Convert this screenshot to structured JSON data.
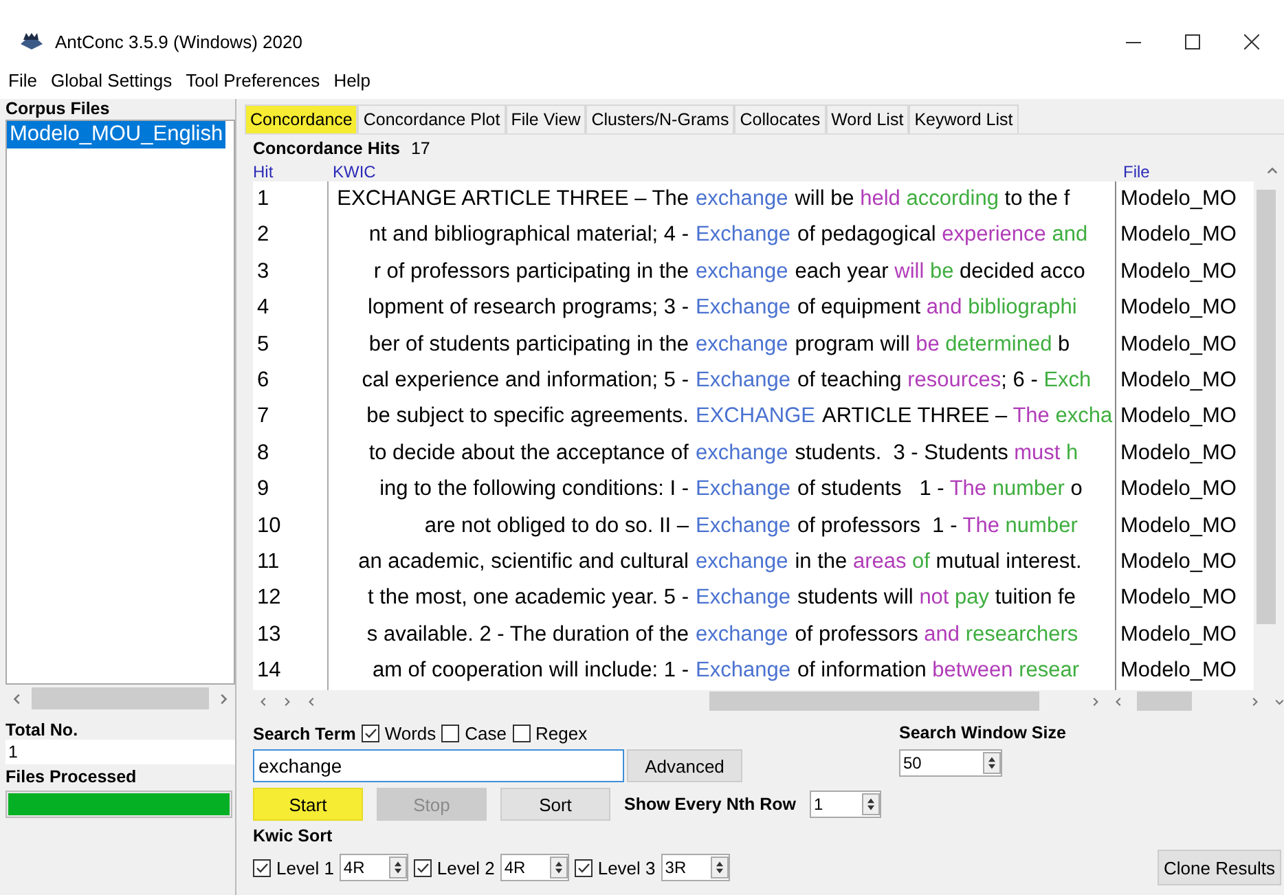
{
  "window": {
    "title": "AntConc 3.5.9 (Windows) 2020"
  },
  "menu": [
    "File",
    "Global Settings",
    "Tool Preferences",
    "Help"
  ],
  "sidebar": {
    "heading": "Corpus Files",
    "files": [
      {
        "label": "Modelo_MOU_English",
        "selected": true
      }
    ],
    "total_label": "Total No.",
    "total": "1",
    "processed_label": "Files Processed",
    "level": 1
  },
  "tabs": [
    {
      "label": "Concordance",
      "selected": true
    },
    {
      "label": "Concordance Plot",
      "selected": false
    },
    {
      "label": "File View",
      "selected": false
    },
    {
      "label": "Clusters/N-Grams",
      "selected": false
    },
    {
      "label": "Collocates",
      "selected": false
    },
    {
      "label": "Word List",
      "selected": false
    },
    {
      "label": "Keyword List",
      "selected": false
    }
  ],
  "hits": {
    "label": "Concordance Hits",
    "count": "17"
  },
  "table": {
    "columns": [
      "Hit",
      "KWIC",
      "File"
    ],
    "rows": [
      {
        "hit": "1",
        "left": "EXCHANGE  ARTICLE THREE – The",
        "keyword": "exchange",
        "right": [
          {
            "text": "will be ",
            "color": "#000000"
          },
          {
            "text": "held",
            "color": "#b03cb8"
          },
          {
            "text": " according",
            "color": "#3fae3f"
          },
          {
            "text": " to the f",
            "color": "#000000"
          }
        ],
        "file": "Modelo_MO"
      },
      {
        "hit": "2",
        "left": "nt and bibliographical material; 4 -",
        "keyword": "Exchange",
        "right": [
          {
            "text": "of pedagogical ",
            "color": "#000000"
          },
          {
            "text": "experience",
            "color": "#b03cb8"
          },
          {
            "text": " and",
            "color": "#3fae3f"
          }
        ],
        "file": "Modelo_MO"
      },
      {
        "hit": "3",
        "left": "r of professors participating in the",
        "keyword": "exchange",
        "right": [
          {
            "text": "each year ",
            "color": "#000000"
          },
          {
            "text": "will",
            "color": "#b03cb8"
          },
          {
            "text": " be",
            "color": "#3fae3f"
          },
          {
            "text": " decided acco",
            "color": "#000000"
          }
        ],
        "file": "Modelo_MO"
      },
      {
        "hit": "4",
        "left": "lopment of research programs; 3 -",
        "keyword": "Exchange",
        "right": [
          {
            "text": "of equipment ",
            "color": "#000000"
          },
          {
            "text": "and",
            "color": "#b03cb8"
          },
          {
            "text": " bibliographi",
            "color": "#3fae3f"
          }
        ],
        "file": "Modelo_MO"
      },
      {
        "hit": "5",
        "left": "ber of students participating in the",
        "keyword": "exchange",
        "right": [
          {
            "text": "program will ",
            "color": "#000000"
          },
          {
            "text": "be",
            "color": "#b03cb8"
          },
          {
            "text": " determined",
            "color": "#3fae3f"
          },
          {
            "text": " b",
            "color": "#000000"
          }
        ],
        "file": "Modelo_MO"
      },
      {
        "hit": "6",
        "left": "cal experience and information; 5 -",
        "keyword": "Exchange",
        "right": [
          {
            "text": "of teaching ",
            "color": "#000000"
          },
          {
            "text": "resources",
            "color": "#b03cb8"
          },
          {
            "text": "; 6 - ",
            "color": "#000000"
          },
          {
            "text": "Exch",
            "color": "#3fae3f"
          }
        ],
        "file": "Modelo_MO"
      },
      {
        "hit": "7",
        "left": "be subject to specific agreements.",
        "keyword": "EXCHANGE",
        "right": [
          {
            "text": "ARTICLE THREE – ",
            "color": "#000000"
          },
          {
            "text": "The",
            "color": "#b03cb8"
          },
          {
            "text": " excha",
            "color": "#3fae3f"
          }
        ],
        "file": "Modelo_MO"
      },
      {
        "hit": "8",
        "left": "to decide about the acceptance of",
        "keyword": "exchange",
        "right": [
          {
            "text": "students.  3 - Students ",
            "color": "#000000"
          },
          {
            "text": "must",
            "color": "#b03cb8"
          },
          {
            "text": " h",
            "color": "#3fae3f"
          }
        ],
        "file": "Modelo_MO"
      },
      {
        "hit": "9",
        "left": "ing to the following conditions:  I -",
        "keyword": "Exchange",
        "right": [
          {
            "text": "of students   1 - ",
            "color": "#000000"
          },
          {
            "text": "The",
            "color": "#b03cb8"
          },
          {
            "text": " number",
            "color": "#3fae3f"
          },
          {
            "text": " o",
            "color": "#000000"
          }
        ],
        "file": "Modelo_MO"
      },
      {
        "hit": "10",
        "left": "are not obliged to do so.   II –",
        "keyword": "Exchange",
        "right": [
          {
            "text": "of professors  1 - ",
            "color": "#000000"
          },
          {
            "text": "The",
            "color": "#b03cb8"
          },
          {
            "text": " number",
            "color": "#3fae3f"
          }
        ],
        "file": "Modelo_MO"
      },
      {
        "hit": "11",
        "left": "an academic, scientific and cultural",
        "keyword": "exchange",
        "right": [
          {
            "text": "in the ",
            "color": "#000000"
          },
          {
            "text": "areas",
            "color": "#b03cb8"
          },
          {
            "text": " of",
            "color": "#3fae3f"
          },
          {
            "text": " mutual interest.",
            "color": "#000000"
          }
        ],
        "file": "Modelo_MO"
      },
      {
        "hit": "12",
        "left": "t the most, one academic year.  5 -",
        "keyword": "Exchange",
        "right": [
          {
            "text": "students will ",
            "color": "#000000"
          },
          {
            "text": "not",
            "color": "#b03cb8"
          },
          {
            "text": " pay",
            "color": "#3fae3f"
          },
          {
            "text": " tuition fe",
            "color": "#000000"
          }
        ],
        "file": "Modelo_MO"
      },
      {
        "hit": "13",
        "left": "s available.  2 - The duration of the",
        "keyword": "exchange",
        "right": [
          {
            "text": "of professors ",
            "color": "#000000"
          },
          {
            "text": "and",
            "color": "#b03cb8"
          },
          {
            "text": " researchers",
            "color": "#3fae3f"
          }
        ],
        "file": "Modelo_MO"
      },
      {
        "hit": "14",
        "left": "am of cooperation will include:  1 -",
        "keyword": "Exchange",
        "right": [
          {
            "text": "of information ",
            "color": "#000000"
          },
          {
            "text": "between",
            "color": "#b03cb8"
          },
          {
            "text": " resear",
            "color": "#3fae3f"
          }
        ],
        "file": "Modelo_MO"
      }
    ]
  },
  "search": {
    "label": "Search Term",
    "options": [
      {
        "label": "Words",
        "checked": true
      },
      {
        "label": "Case",
        "checked": false
      },
      {
        "label": "Regex",
        "checked": false
      }
    ],
    "value": "exchange",
    "advanced": "Advanced",
    "window_label": "Search Window Size",
    "window_value": "50"
  },
  "buttons": [
    {
      "label": "Start",
      "highlighted": true,
      "disabled": false
    },
    {
      "label": "Stop",
      "highlighted": false,
      "disabled": true
    },
    {
      "label": "Sort",
      "highlighted": false,
      "disabled": false
    }
  ],
  "nth": {
    "label": "Show Every Nth Row",
    "value": "1"
  },
  "kwic_sort": {
    "label": "Kwic Sort",
    "levels": [
      {
        "label": "Level 1",
        "checked": true,
        "value": "4R"
      },
      {
        "label": "Level 2",
        "checked": true,
        "value": "4R"
      },
      {
        "label": "Level 3",
        "checked": true,
        "value": "3R"
      }
    ]
  },
  "clone": "Clone Results"
}
